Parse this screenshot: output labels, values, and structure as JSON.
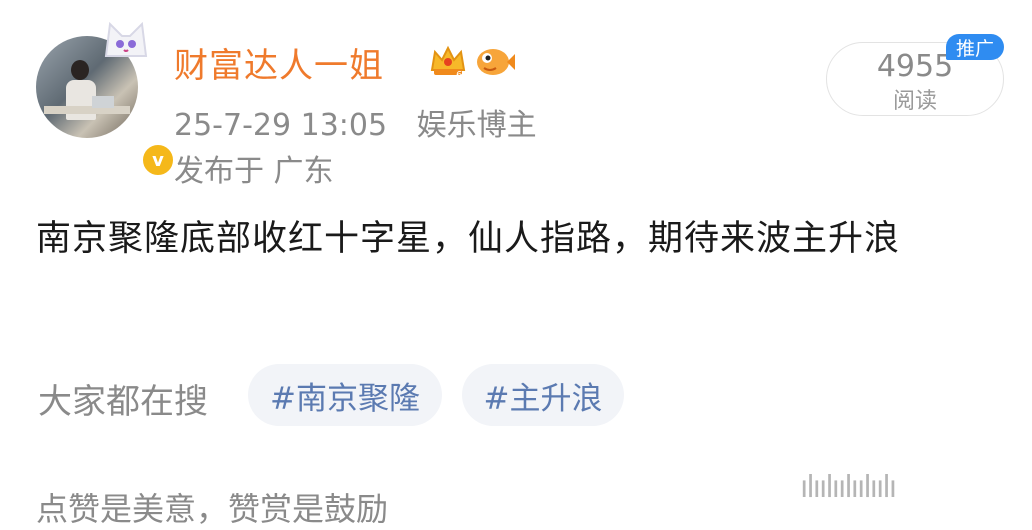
{
  "post": {
    "username": "财富达人一姐",
    "timestamp": "25-7-29 13:05",
    "category": "娱乐博主",
    "location": "发布于 广东",
    "read_count": "4955",
    "read_label": "阅读",
    "ad_label": "推广",
    "content": "南京聚隆底部收红十字星，仙人指路，期待来波主升浪",
    "verified_badge": "v"
  },
  "search": {
    "label": "大家都在搜",
    "topics": [
      "#南京聚隆",
      "#主升浪"
    ]
  },
  "footer": {
    "text": "点赞是美意，赞赏是鼓励",
    "watermark": "ılıılıılıılıılı"
  },
  "colors": {
    "username": "#ef7a2c",
    "meta": "#8a8a8a",
    "chip_text": "#5b7ab1",
    "chip_bg": "#f2f4f8",
    "ad_badge": "#2f8cf1",
    "verified_badge": "#f5b81a"
  },
  "icons": [
    "cat-ears-icon",
    "verified-icon",
    "crown-icon",
    "fish-icon"
  ]
}
